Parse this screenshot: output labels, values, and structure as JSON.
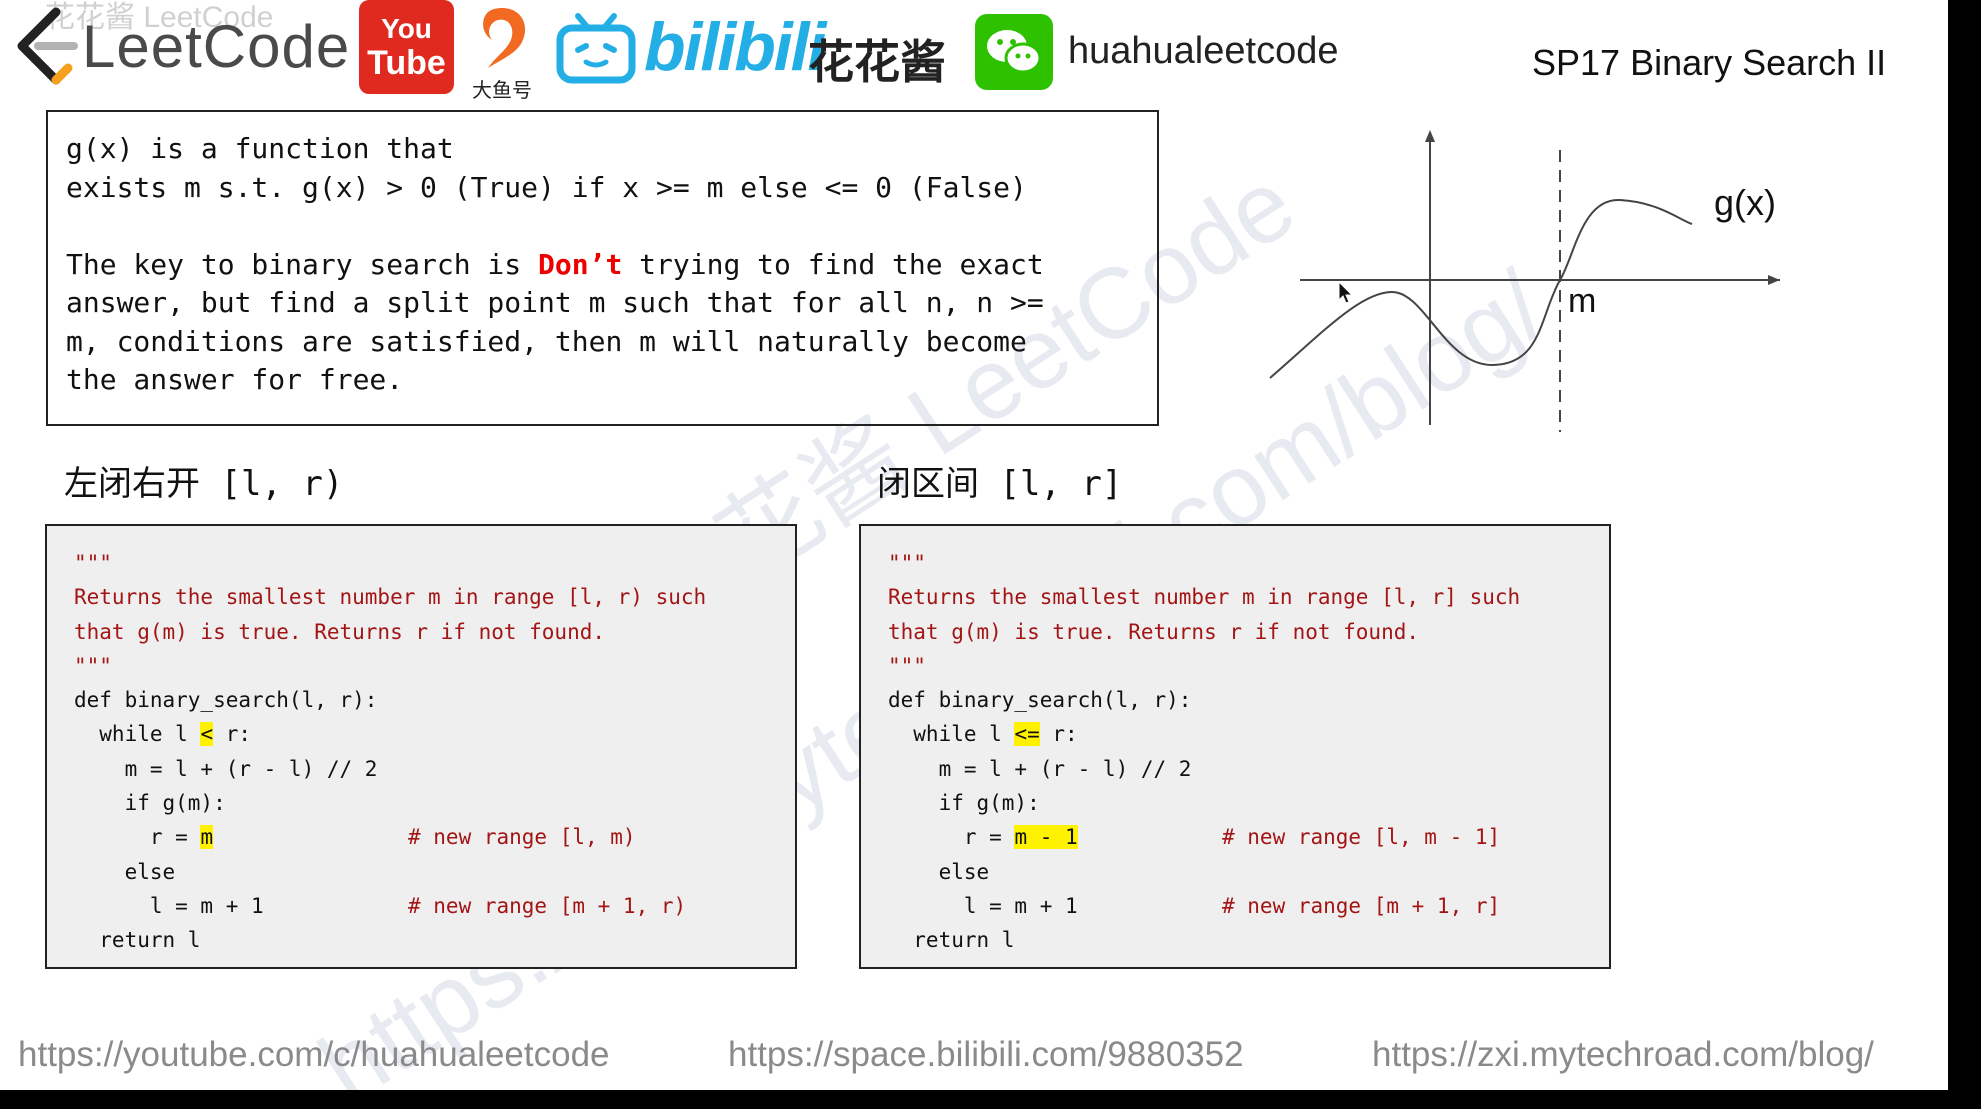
{
  "header": {
    "leetcode_logo_text": "LeetCode",
    "youtube_logo_line1": "You",
    "youtube_logo_line2": "Tube",
    "dayu_label": "大鱼号",
    "bilibili_logo_text": "bilibili",
    "huahua_cn": "花花酱",
    "wechat_handle": "huahualeetcode",
    "slide_title": "SP17 Binary Search II",
    "watermark_top": "花花酱 LeetCode"
  },
  "intro": {
    "line1": "g(x) is a function that",
    "line2": "exists m s.t. g(x) > 0 (True) if x >= m else <= 0 (False)",
    "line3_pre": "The key to binary search is ",
    "line3_red": "Don’t",
    "line3_post": " trying to find the exact",
    "line4": "answer, but find a split point m such that for all n, n >=",
    "line5": "m, conditions are satisfied, then m will naturally become",
    "line6": "the answer for free."
  },
  "graph": {
    "function_label": "g(x)",
    "split_label": "m"
  },
  "left_section": {
    "heading_cn": "左闭右开",
    "heading_interval": " [l, r)",
    "code": {
      "doc_open": "\"\"\"",
      "doc1": "Returns the smallest number m in range [l, r) such",
      "doc2": "that g(m) is true. Returns r if not found.",
      "doc_close": "\"\"\"",
      "def": "def binary_search(l, r):",
      "while_pre": "  while l ",
      "while_op": "<",
      "while_post": " r:",
      "mid": "    m = l + (r - l) // 2",
      "if": "    if g(m):",
      "assign_pre": "      r = ",
      "assign_hl": "m",
      "assign_comment": "# new range [l, m)",
      "else": "    else",
      "l_assign": "      l = m + 1",
      "l_comment": "# new range [m + 1, r)",
      "ret": "  return l"
    }
  },
  "right_section": {
    "heading_cn": "闭区间",
    "heading_interval": " [l, r]",
    "code": {
      "doc_open": "\"\"\"",
      "doc1": "Returns the smallest number m in range [l, r] such",
      "doc2": "that g(m) is true. Returns r if not found.",
      "doc_close": "\"\"\"",
      "def": "def binary_search(l, r):",
      "while_pre": "  while l ",
      "while_op": "<=",
      "while_post": " r:",
      "mid": "    m = l + (r - l) // 2",
      "if": "    if g(m):",
      "assign_pre": "      r = ",
      "assign_hl": "m - 1",
      "assign_comment": "# new range [l, m - 1]",
      "else": "    else",
      "l_assign": "      l = m + 1",
      "l_comment": "# new range [m + 1, r]",
      "ret": "  return l"
    }
  },
  "footer": {
    "youtube_url": "https://youtube.com/c/huahualeetcode",
    "bilibili_url": "https://space.bilibili.com/9880352",
    "blog_url": "https://zxi.mytechroad.com/blog/"
  },
  "colors": {
    "highlight": "#fff200",
    "docstring": "#a31515",
    "emphasis_red": "#e00000",
    "youtube_red": "#e02a20",
    "bilibili_blue": "#23aee5",
    "wechat_green": "#2dc100",
    "leetcode_orange": "#f89f1b"
  }
}
